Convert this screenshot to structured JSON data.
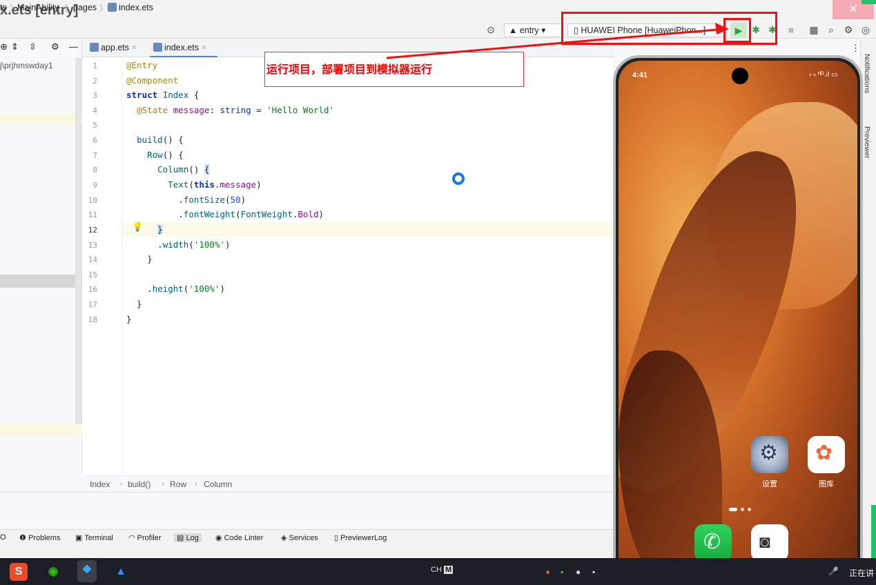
{
  "window": {
    "title": "x.ets [entry]"
  },
  "nav": {
    "breadcrumbs": [
      "ts",
      "MainAbility",
      "pages",
      "index.ets"
    ],
    "entry_module": "entry",
    "device": "HUAWEI Phone [HuaweiPhon...]"
  },
  "annotation": {
    "text": "运行项目，部署项目到模拟器运行",
    "color": "#e11111"
  },
  "project": {
    "path": "j\\prjhmswday1"
  },
  "tabs": [
    {
      "label": "app.ets",
      "active": false
    },
    {
      "label": "index.ets",
      "active": true
    }
  ],
  "editor": {
    "line_numbers": [
      "1",
      "2",
      "3",
      "4",
      "5",
      "6",
      "7",
      "8",
      "9",
      "10",
      "11",
      "12",
      "13",
      "14",
      "15",
      "16",
      "17",
      "18"
    ],
    "current_line": "12"
  },
  "code_breadcrumb": [
    "Index",
    "build()",
    "Row",
    "Column"
  ],
  "bottom_tools": [
    "Problems",
    "Terminal",
    "Profiler",
    "Log",
    "Code Linter",
    "Services",
    "PreviewerLog"
  ],
  "side_panels": [
    "Notifications",
    "Previewer"
  ],
  "taskbar": {
    "ime": "CH",
    "ime_mode": "M",
    "live_text": "正在讲"
  },
  "phone": {
    "time": "4:41",
    "status_icons": "‹·› ᴴᴰ.ıl ▭",
    "apps": [
      {
        "label": "设置",
        "icon": "settings-gear-icon"
      },
      {
        "label": "图库",
        "icon": "gallery-flower-icon"
      }
    ],
    "dock": [
      {
        "icon": "phone-call-icon"
      },
      {
        "icon": "camera-icon"
      }
    ],
    "page_count": 3,
    "active_page": 1
  },
  "colors": {
    "highlight": "#e11111",
    "run_green": "#3a9a42",
    "tab_accent": "#4a86e8"
  }
}
